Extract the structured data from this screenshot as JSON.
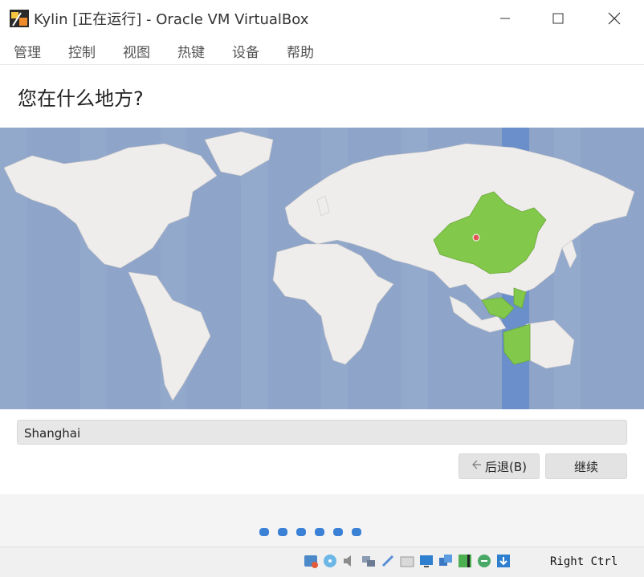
{
  "window": {
    "title": "Kylin [正在运行] - Oracle VM VirtualBox"
  },
  "menu": {
    "items": [
      "管理",
      "控制",
      "视图",
      "热键",
      "设备",
      "帮助"
    ]
  },
  "installer": {
    "heading": "您在什么地方?",
    "location_value": "Shanghai",
    "back_label": "后退(B)",
    "next_label": "继续",
    "progress_dots": 6
  },
  "status": {
    "host_key": "Right Ctrl"
  },
  "colors": {
    "ocean": "#8ea5c9",
    "land": "#efecec",
    "selected_country": "#82c84a",
    "timezone_band": "#6a8fca",
    "dot": "#3b82d6"
  }
}
